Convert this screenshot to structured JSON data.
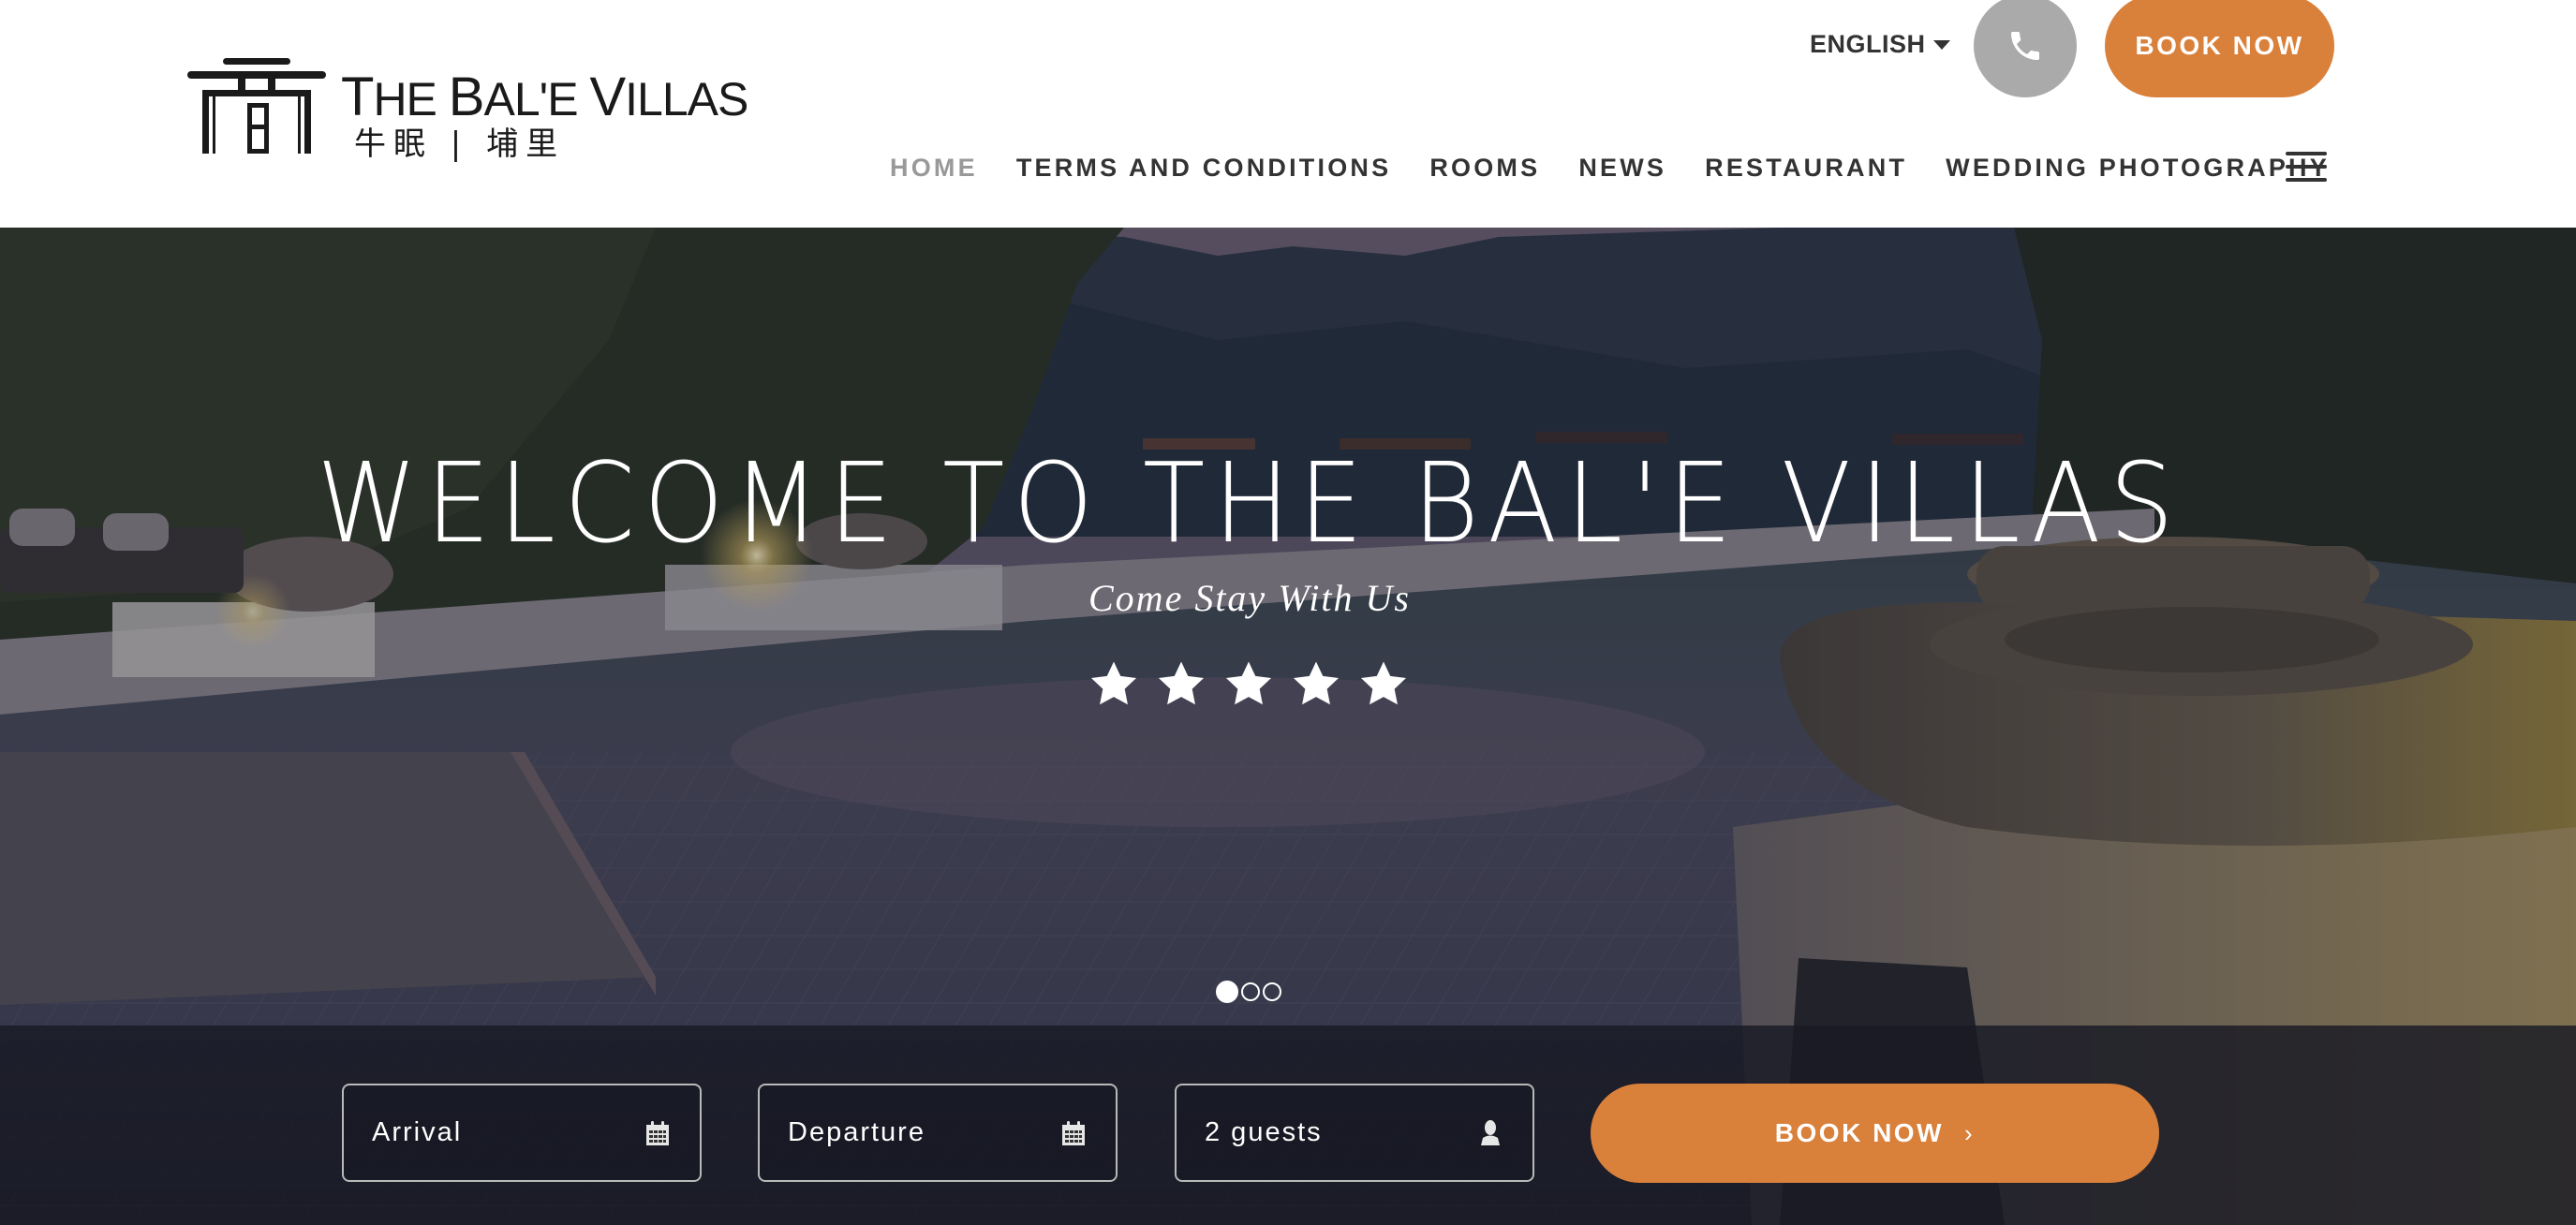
{
  "header": {
    "logo": {
      "name": "THE BAL'E VILLAS",
      "name_parts": [
        "T",
        "HE ",
        "B",
        "AL'E ",
        "V",
        "ILLAS"
      ],
      "subtitle": "牛眠 | 埔里"
    },
    "language": {
      "label": "ENGLISH",
      "icon": "caret-down-icon"
    },
    "phone_button": {
      "icon": "phone-icon"
    },
    "book_now_label": "BOOK NOW",
    "nav": [
      {
        "label": "HOME",
        "active": true
      },
      {
        "label": "TERMS AND CONDITIONS",
        "active": false
      },
      {
        "label": "ROOMS",
        "active": false
      },
      {
        "label": "NEWS",
        "active": false
      },
      {
        "label": "RESTAURANT",
        "active": false
      },
      {
        "label": "WEDDING PHOTOGRAPHY",
        "active": false
      }
    ],
    "menu_icon": "hamburger-menu-icon"
  },
  "hero": {
    "title": "WELCOME TO THE BAL'E VILLAS",
    "subtitle": "Come Stay With Us",
    "rating": {
      "stars": 5,
      "max": 5
    },
    "slider": {
      "total": 3,
      "active_index": 0
    }
  },
  "booking": {
    "arrival": {
      "value": "Arrival",
      "icon": "calendar-icon"
    },
    "departure": {
      "value": "Departure",
      "icon": "calendar-icon"
    },
    "guests": {
      "value": "2 guests",
      "icon": "user-icon"
    },
    "submit_label": "BOOK NOW",
    "submit_icon": "chevron-right-icon",
    "submit_chevron": "›"
  },
  "colors": {
    "accent": "#d9803b",
    "phone_button": "#aaaaaa",
    "nav_text": "#333333",
    "nav_active": "#999999",
    "booking_bar": "#181a24"
  }
}
